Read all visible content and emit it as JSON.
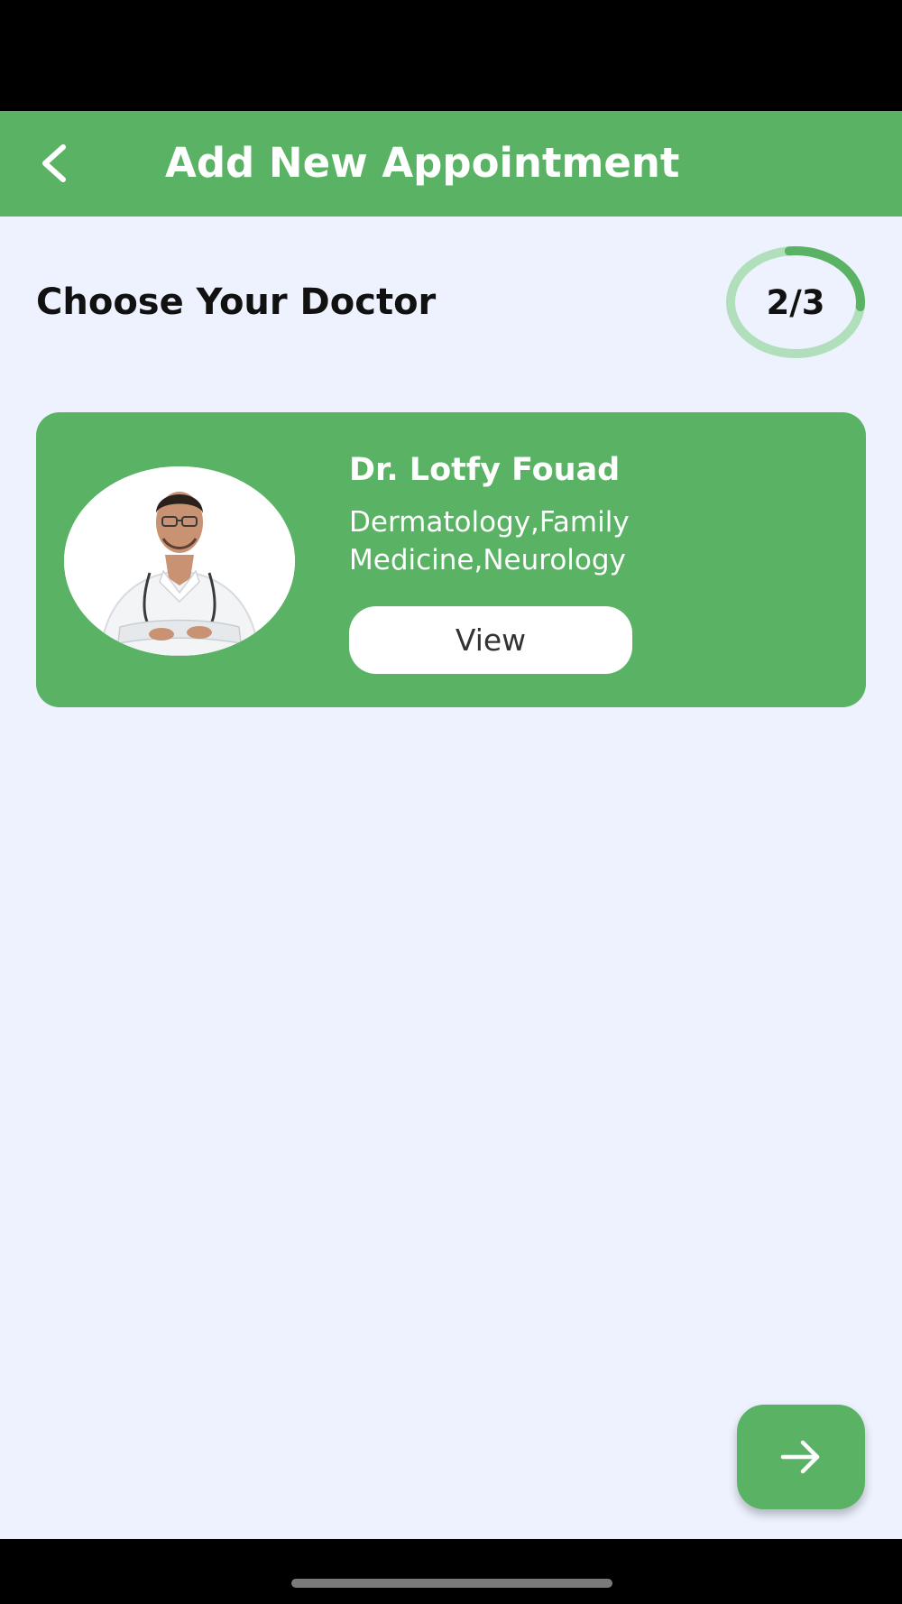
{
  "app_bar": {
    "title": "Add New Appointment",
    "back_icon": "chevron-left-icon"
  },
  "section": {
    "title": "Choose Your Doctor"
  },
  "step": {
    "label": "2/3",
    "current": 2,
    "total": 3
  },
  "doctor": {
    "name": "Dr. Lotfy Fouad",
    "specialties": "Dermatology,Family Medicine,Neurology",
    "view_label": "View",
    "photo_icon": "doctor-photo"
  },
  "next_button": {
    "icon": "arrow-right-icon"
  },
  "colors": {
    "primary": "#5ab264",
    "background": "#edf2fe",
    "progress_track": "#b1dfbc",
    "progress_fill": "#5ab264"
  }
}
